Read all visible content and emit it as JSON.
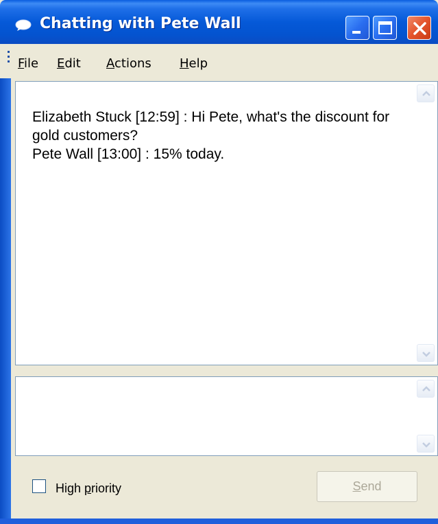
{
  "window": {
    "title": "Chatting with Pete Wall"
  },
  "menu": {
    "file_first": "F",
    "file_rest": "ile",
    "edit_first": "E",
    "edit_rest": "dit",
    "actions_first": "A",
    "actions_rest": "ctions",
    "help_first": "H",
    "help_rest": "elp"
  },
  "transcript": {
    "lines": [
      "Elizabeth Stuck [12:59] : Hi Pete, what's the discount for gold customers?",
      "Pete Wall [13:00] : 15% today."
    ]
  },
  "compose": {
    "high_priority_pre": "High ",
    "high_priority_accel": "p",
    "high_priority_post": "riority",
    "high_priority_checked": false,
    "send_accel": "S",
    "send_rest": "end",
    "send_enabled": false
  },
  "colors": {
    "titlebar": "#0559d8",
    "close_button": "#e4542c",
    "window_bg": "#ece9d8",
    "disabled_text": "#aca899"
  },
  "icons": {
    "title": "chat-bubble-icon",
    "minimize": "minimize-icon",
    "maximize": "maximize-icon",
    "close": "close-icon",
    "scroll_up": "chevron-up-icon",
    "scroll_down": "chevron-down-icon"
  }
}
